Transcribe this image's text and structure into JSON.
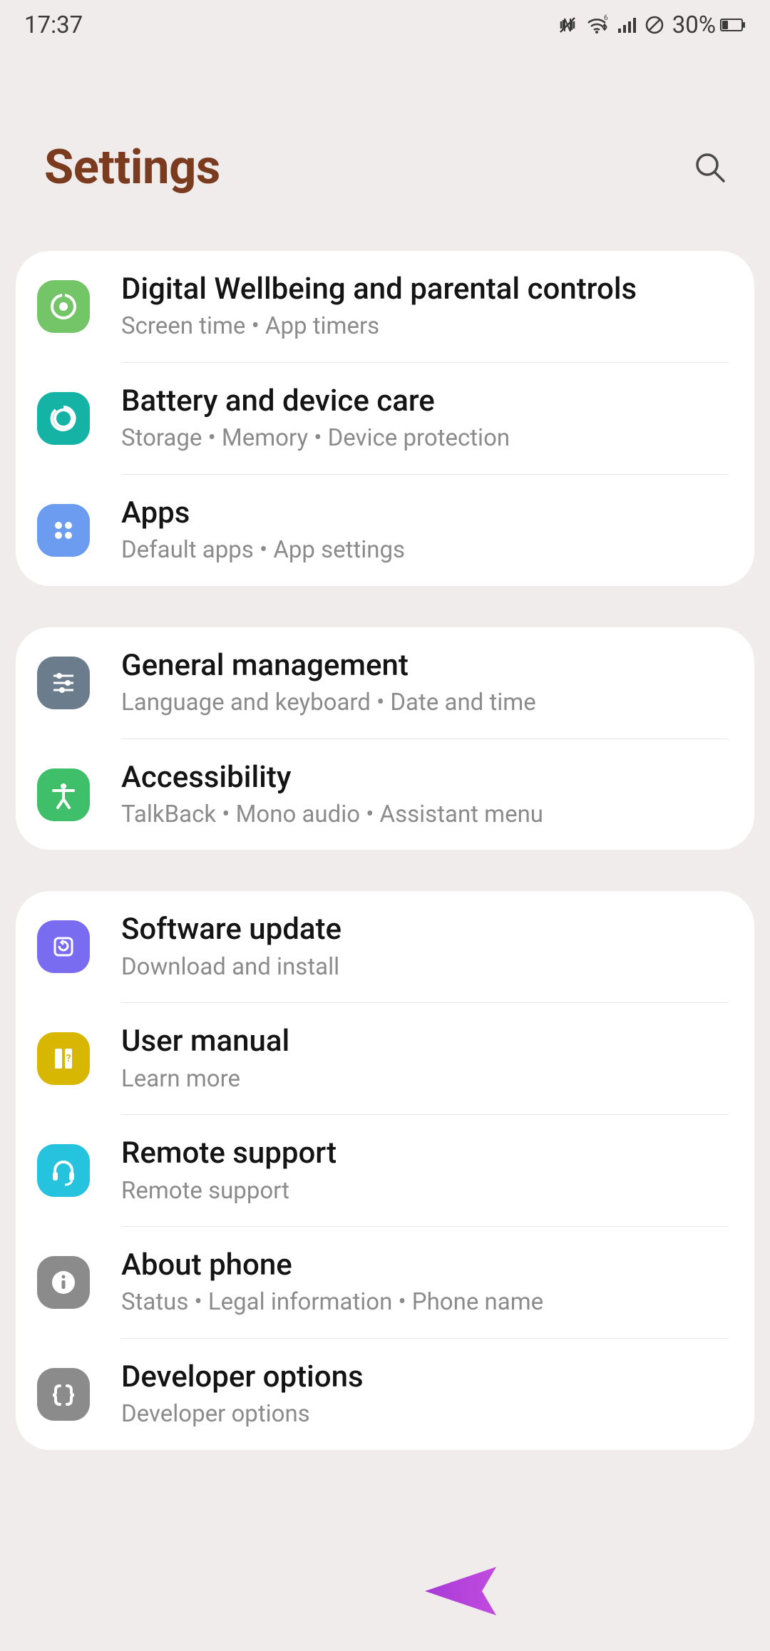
{
  "status": {
    "time": "17:37",
    "battery_pct": "30%"
  },
  "header": {
    "title": "Settings"
  },
  "groups": [
    {
      "items": [
        {
          "key": "digital-wellbeing",
          "icon": "wellbeing-icon",
          "bg": "bg-green1",
          "title": "Digital Wellbeing and parental controls",
          "sub": "Screen time  •  App timers"
        },
        {
          "key": "battery-care",
          "icon": "battery-care-icon",
          "bg": "bg-teal",
          "title": "Battery and device care",
          "sub": "Storage  •  Memory  •  Device protection"
        },
        {
          "key": "apps",
          "icon": "apps-icon",
          "bg": "bg-blue1",
          "title": "Apps",
          "sub": "Default apps  •  App settings"
        }
      ]
    },
    {
      "items": [
        {
          "key": "general-management",
          "icon": "sliders-icon",
          "bg": "bg-slate",
          "title": "General management",
          "sub": "Language and keyboard  •  Date and time"
        },
        {
          "key": "accessibility",
          "icon": "accessibility-icon",
          "bg": "bg-green2",
          "title": "Accessibility",
          "sub": "TalkBack  •  Mono audio  •  Assistant menu"
        }
      ]
    },
    {
      "items": [
        {
          "key": "software-update",
          "icon": "update-icon",
          "bg": "bg-violet",
          "title": "Software update",
          "sub": "Download and install"
        },
        {
          "key": "user-manual",
          "icon": "manual-icon",
          "bg": "bg-yellow",
          "title": "User manual",
          "sub": "Learn more"
        },
        {
          "key": "remote-support",
          "icon": "headset-icon",
          "bg": "bg-cyan",
          "title": "Remote support",
          "sub": "Remote support"
        },
        {
          "key": "about-phone",
          "icon": "info-icon",
          "bg": "bg-gray",
          "title": "About phone",
          "sub": "Status  •  Legal information  •  Phone name"
        },
        {
          "key": "developer-options",
          "icon": "braces-icon",
          "bg": "bg-gray",
          "title": "Developer options",
          "sub": "Developer options"
        }
      ]
    }
  ],
  "icons": {
    "wellbeing-icon": "<circle cx='22' cy='22' r='16' fill='none' stroke='white' stroke-width='4'/><circle cx='22' cy='22' r='6' fill='white'/><rect x='20' y='4' width='4' height='4' fill='#74c567'/>",
    "battery-care-icon": "<circle cx='22' cy='22' r='12' fill='none' stroke='white' stroke-width='4'/><path d='M22 6 a16 16 0 1 1 -11 4' fill='none' stroke='white' stroke-width='4'/>",
    "apps-icon": "<circle cx='15' cy='15' r='5' fill='white'/><circle cx='29' cy='15' r='5' fill='white'/><circle cx='15' cy='29' r='5' fill='white'/><circle cx='29' cy='29' r='5' fill='white'/>",
    "sliders-icon": "<line x1='8' y1='12' x2='36' y2='12' stroke='white' stroke-width='3'/><circle cx='16' cy='12' r='4' fill='white'/><line x1='8' y1='22' x2='36' y2='22' stroke='white' stroke-width='3'/><circle cx='28' cy='22' r='4' fill='white'/><line x1='8' y1='32' x2='36' y2='32' stroke='white' stroke-width='3'/><circle cx='20' cy='32' r='4' fill='white'/>",
    "accessibility-icon": "<circle cx='22' cy='10' r='4' fill='white'/><path d='M8 16 L36 16 M22 16 L22 28 M22 28 L14 40 M22 28 L30 40' stroke='white' stroke-width='4' stroke-linecap='round' fill='none'/>",
    "update-icon": "<rect x='10' y='10' width='24' height='24' rx='5' fill='none' stroke='white' stroke-width='3'/><path d='M22 15 a6 6 0 1 1 -6 6' fill='none' stroke='white' stroke-width='3'/><path d='M22 13 l-3 3 l3 3' fill='none' stroke='white' stroke-width='3'/>",
    "manual-icon": "<rect x='10' y='8' width='10' height='28' rx='2' fill='white'/><rect x='24' y='8' width='10' height='28' rx='2' fill='white'/><text x='29' y='26' font-size='14' text-anchor='middle' fill='#d7b702' font-weight='bold'>?</text>",
    "headset-icon": "<path d='M10 26 v-4 a12 12 0 0 1 24 0 v4' fill='none' stroke='white' stroke-width='4'/><rect x='7' y='24' width='7' height='12' rx='3' fill='white'/><rect x='30' y='24' width='7' height='12' rx='3' fill='white'/><path d='M34 36 q-2 6 -10 6' fill='none' stroke='white' stroke-width='3'/>",
    "info-icon": "<circle cx='22' cy='22' r='16' fill='white'/><circle cx='22' cy='14' r='2.5' fill='#8b8b8b'/><rect x='19.5' y='19' width='5' height='12' rx='2' fill='#8b8b8b'/>",
    "braces-icon": "<path d='M17 10 q-6 0 -6 6 v3 q0 4 -4 4 q4 0 4 4 v3 q0 6 6 6' fill='none' stroke='white' stroke-width='4' stroke-linecap='round'/><path d='M27 10 q6 0 6 6 v3 q0 4 4 4 q-4 0 -4 4 v3 q0 6 -6 6' fill='none' stroke='white' stroke-width='4' stroke-linecap='round'/>"
  }
}
